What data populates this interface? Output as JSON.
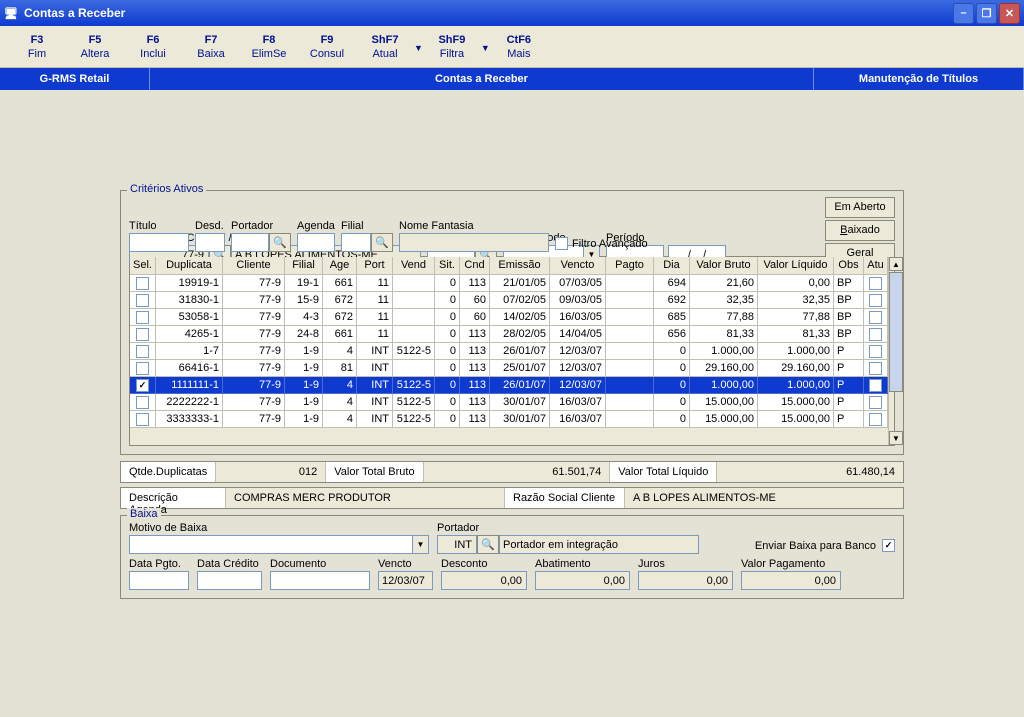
{
  "window": {
    "title": "Contas a Receber"
  },
  "menu": [
    {
      "key": "F3",
      "label": "Fim"
    },
    {
      "key": "F5",
      "label": "Altera"
    },
    {
      "key": "F6",
      "label": "Inclui"
    },
    {
      "key": "F7",
      "label": "Baixa"
    },
    {
      "key": "F8",
      "label": "ElimSe"
    },
    {
      "key": "F9",
      "label": "Consul"
    },
    {
      "key": "ShF7",
      "label": "Atual",
      "caret": true
    },
    {
      "key": "ShF9",
      "label": "Filtra",
      "caret": true
    },
    {
      "key": "CtF6",
      "label": "Mais"
    }
  ],
  "module": {
    "left": "G-RMS Retail",
    "center": "Contas a Receber",
    "right": "Manutenção de Títulos"
  },
  "criteria": {
    "legend": "Critérios Ativos",
    "cliente_label": "Cliente (CGC / CPF / Código)",
    "cliente_codigo": "77-9",
    "cliente_nome": "A B LOPES ALIMENTOS-ME",
    "vendedor_label": "Vendedor",
    "tipo_periodo_label": "Tipo Período",
    "periodo_label": "Período",
    "periodo_mask": "__/__/__",
    "titulo_label": "Título",
    "desd_label": "Desd.",
    "portador_label": "Portador",
    "agenda_label": "Agenda",
    "filial_label": "Filial",
    "nome_fantasia_label": "Nome Fantasia",
    "filtro_avancado": "Filtro Avançado",
    "btn_emaberto": "Em Aberto",
    "btn_baixado": "Baixado",
    "btn_geral": "Geral"
  },
  "grid": {
    "headers": [
      "Sel.",
      "Duplicata",
      "Cliente",
      "Filial",
      "Age",
      "Port",
      "Vend",
      "Sit.",
      "Cnd",
      "Emissão",
      "Vencto",
      "Pagto",
      "Dia",
      "Valor Bruto",
      "Valor Líquido",
      "Obs",
      "Atu"
    ],
    "rows": [
      {
        "sel": false,
        "dup": "19919-1",
        "cli": "77-9",
        "fil": "19-1",
        "age": "661",
        "port": "11",
        "vend": "",
        "sit": "0",
        "cnd": "113",
        "emi": "21/01/05",
        "ven": "07/03/05",
        "pgt": "",
        "dia": "694",
        "vb": "21,60",
        "vl": "0,00",
        "obs": "BP"
      },
      {
        "sel": false,
        "dup": "31830-1",
        "cli": "77-9",
        "fil": "15-9",
        "age": "672",
        "port": "11",
        "vend": "",
        "sit": "0",
        "cnd": "60",
        "emi": "07/02/05",
        "ven": "09/03/05",
        "pgt": "",
        "dia": "692",
        "vb": "32,35",
        "vl": "32,35",
        "obs": "BP"
      },
      {
        "sel": false,
        "dup": "53058-1",
        "cli": "77-9",
        "fil": "4-3",
        "age": "672",
        "port": "11",
        "vend": "",
        "sit": "0",
        "cnd": "60",
        "emi": "14/02/05",
        "ven": "16/03/05",
        "pgt": "",
        "dia": "685",
        "vb": "77,88",
        "vl": "77,88",
        "obs": "BP"
      },
      {
        "sel": false,
        "dup": "4265-1",
        "cli": "77-9",
        "fil": "24-8",
        "age": "661",
        "port": "11",
        "vend": "",
        "sit": "0",
        "cnd": "113",
        "emi": "28/02/05",
        "ven": "14/04/05",
        "pgt": "",
        "dia": "656",
        "vb": "81,33",
        "vl": "81,33",
        "obs": "BP"
      },
      {
        "sel": false,
        "dup": "1-7",
        "cli": "77-9",
        "fil": "1-9",
        "age": "4",
        "port": "INT",
        "vend": "5122-5",
        "sit": "0",
        "cnd": "113",
        "emi": "26/01/07",
        "ven": "12/03/07",
        "pgt": "",
        "dia": "0",
        "vb": "1.000,00",
        "vl": "1.000,00",
        "obs": "P"
      },
      {
        "sel": false,
        "dup": "66416-1",
        "cli": "77-9",
        "fil": "1-9",
        "age": "81",
        "port": "INT",
        "vend": "",
        "sit": "0",
        "cnd": "113",
        "emi": "25/01/07",
        "ven": "12/03/07",
        "pgt": "",
        "dia": "0",
        "vb": "29.160,00",
        "vl": "29.160,00",
        "obs": "P"
      },
      {
        "sel": true,
        "dup": "1111111-1",
        "cli": "77-9",
        "fil": "1-9",
        "age": "4",
        "port": "INT",
        "vend": "5122-5",
        "sit": "0",
        "cnd": "113",
        "emi": "26/01/07",
        "ven": "12/03/07",
        "pgt": "",
        "dia": "0",
        "vb": "1.000,00",
        "vl": "1.000,00",
        "obs": "P",
        "hl": true
      },
      {
        "sel": false,
        "dup": "2222222-1",
        "cli": "77-9",
        "fil": "1-9",
        "age": "4",
        "port": "INT",
        "vend": "5122-5",
        "sit": "0",
        "cnd": "113",
        "emi": "30/01/07",
        "ven": "16/03/07",
        "pgt": "",
        "dia": "0",
        "vb": "15.000,00",
        "vl": "15.000,00",
        "obs": "P"
      },
      {
        "sel": false,
        "dup": "3333333-1",
        "cli": "77-9",
        "fil": "1-9",
        "age": "4",
        "port": "INT",
        "vend": "5122-5",
        "sit": "0",
        "cnd": "113",
        "emi": "30/01/07",
        "ven": "16/03/07",
        "pgt": "",
        "dia": "0",
        "vb": "15.000,00",
        "vl": "15.000,00",
        "obs": "P"
      }
    ]
  },
  "summary": {
    "qtde_label": "Qtde.Duplicatas",
    "qtde": "012",
    "vtb_label": "Valor Total Bruto",
    "vtb": "61.501,74",
    "vtl_label": "Valor Total Líquido",
    "vtl": "61.480,14"
  },
  "desc": {
    "agenda_label": "Descrição Agenda",
    "agenda": "COMPRAS MERC PRODUTOR",
    "razao_label": "Razão Social Cliente",
    "razao": "A B LOPES ALIMENTOS-ME"
  },
  "baixa": {
    "legend": "Baixa",
    "motivo_label": "Motivo de Baixa",
    "portador_label": "Portador",
    "portador_val": "INT",
    "portador_desc": "Portador em integração",
    "enviar_label": "Enviar Baixa para Banco",
    "enviar_checked": true,
    "data_pgto_label": "Data Pgto.",
    "data_credito_label": "Data Crédito",
    "documento_label": "Documento",
    "vencto_label": "Vencto",
    "vencto_val": "12/03/07",
    "desconto_label": "Desconto",
    "desconto_val": "0,00",
    "abatimento_label": "Abatimento",
    "abatimento_val": "0,00",
    "juros_label": "Juros",
    "juros_val": "0,00",
    "vpag_label": "Valor Pagamento",
    "vpag_val": "0,00"
  }
}
